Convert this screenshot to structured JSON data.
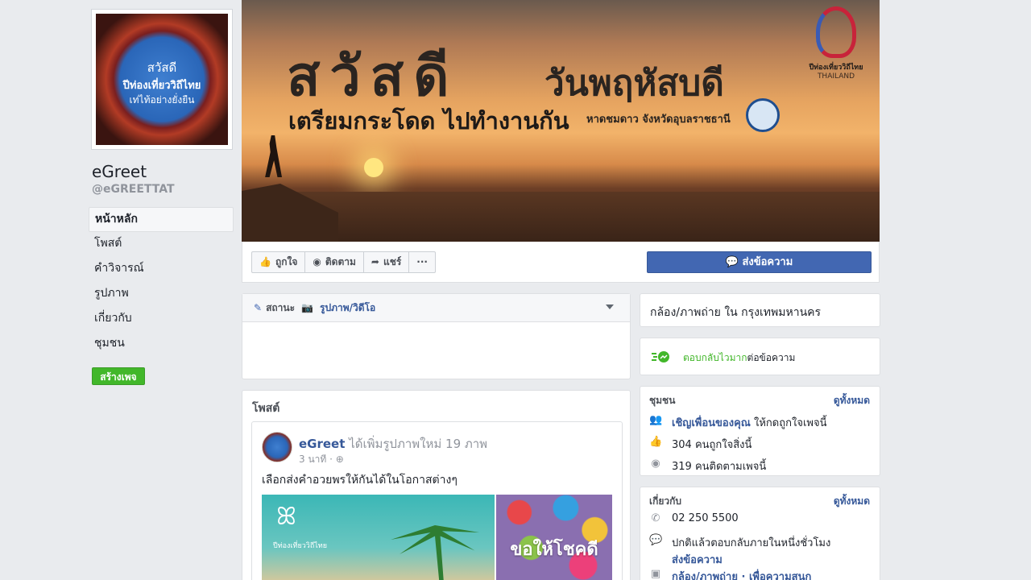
{
  "profile": {
    "pic_line1": "สวัสดี",
    "pic_line2": "ปีท่องเที่ยววิถีไทย",
    "pic_line3": "เท่ไท้อย่างยั่งยืน",
    "name": "eGreet",
    "handle": "@eGREETTAT"
  },
  "left_nav": {
    "items": [
      {
        "label": "หน้าหลัก"
      },
      {
        "label": "โพสต์"
      },
      {
        "label": "คำวิจารณ์"
      },
      {
        "label": "รูปภาพ"
      },
      {
        "label": "เกี่ยวกับ"
      },
      {
        "label": "ชุมชน"
      }
    ],
    "create_button": "สร้างเพจ"
  },
  "cover": {
    "headline": "สวัสดี",
    "day": "วันพฤหัสบดี",
    "subline": "เตรียมกระโดด ไปทำงานกัน",
    "location": "หาดชมดาว จังหวัดอุบลราชธานี",
    "brand_line1": "ปีท่องเที่ยววิถีไทย",
    "brand_line2": "THAILAND"
  },
  "actions": {
    "like": "ถูกใจ",
    "follow": "ติดตาม",
    "share": "แชร์",
    "more": "···",
    "send_message": "ส่งข้อความ"
  },
  "composer": {
    "status": "สถานะ",
    "photo_video": "รูปภาพ/วิดีโอ"
  },
  "posts": {
    "title": "โพสต์",
    "post": {
      "author": "eGreet",
      "action": "ได้เพิ่มรูปภาพใหม่ 19 ภาพ",
      "time": "3 นาที ·",
      "text": "เลือกส่งคำอวยพรให้กันได้ในโอกาสต่างๆ",
      "img1_text": "ปีท่องเที่ยววิถีไทย",
      "img2_text": "ขอให้โชคดี"
    }
  },
  "right": {
    "category": "กล้อง/ภาพถ่าย ใน กรุงเทพมหานคร",
    "response_fast": "ตอบกลับไวมาก",
    "response_rest": "ต่อข้อความ",
    "community": {
      "title": "ชุมชน",
      "see_all": "ดูทั้งหมด",
      "invite_link": "เชิญเพื่อนของคุณ",
      "invite_rest": "ให้กดถูกใจเพจนี้",
      "likes": "304 คนถูกใจสิ่งนี้",
      "follows": "319 คนติดตามเพจนี้"
    },
    "about": {
      "title": "เกี่ยวกับ",
      "see_all": "ดูทั้งหมด",
      "phone": "02 250 5500",
      "reply_time": "ปกติแล้วตอบกลับภายในหนึ่งชั่วโมง",
      "send_message": "ส่งข้อความ",
      "category": "กล้อง/ภาพถ่าย · เพื่อความสนุก"
    }
  }
}
